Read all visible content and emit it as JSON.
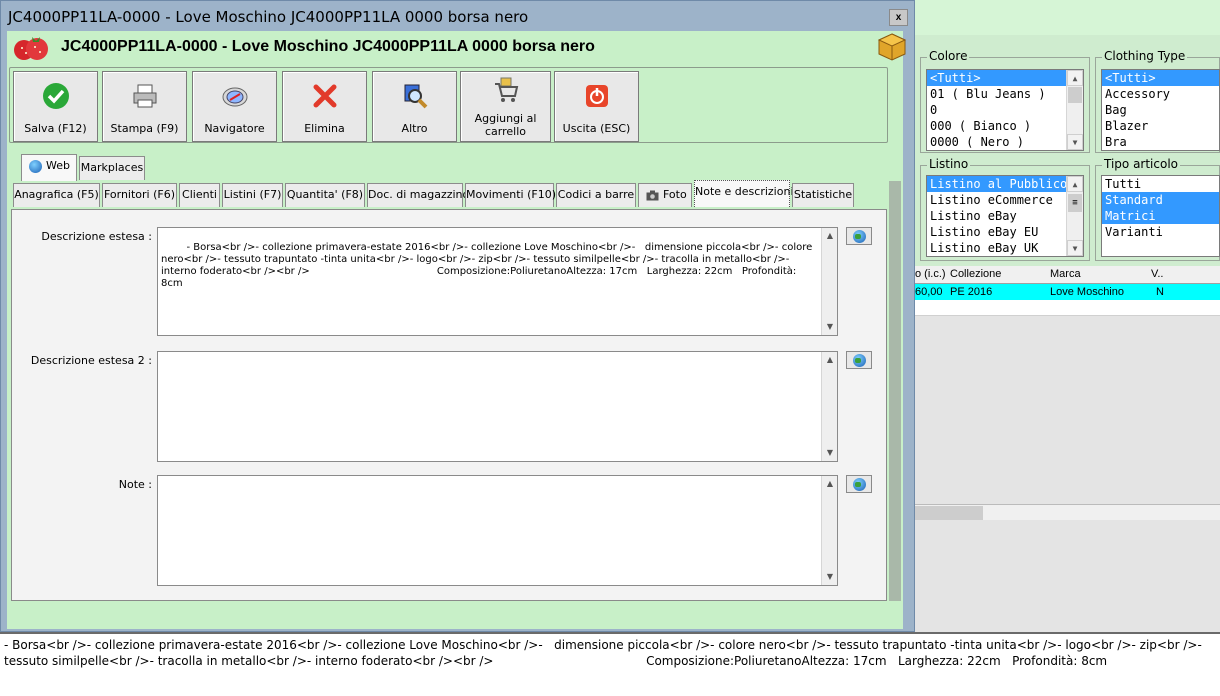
{
  "window": {
    "title": "JC4000PP11LA-0000 - Love Moschino JC4000PP11LA 0000 borsa nero",
    "header_title": "JC4000PP11LA-0000 - Love Moschino JC4000PP11LA 0000 borsa nero",
    "close_label": "x"
  },
  "toolbar": {
    "buttons": [
      {
        "label": "Salva (F12)",
        "icon": "checkmark-icon"
      },
      {
        "label": "Stampa (F9)",
        "icon": "printer-icon"
      },
      {
        "label": "Navigatore",
        "icon": "compass-icon"
      },
      {
        "label": "Elimina",
        "icon": "delete-x-icon"
      },
      {
        "label": "Altro",
        "icon": "magnifier-icon"
      },
      {
        "label": "Aggiungi al carrello",
        "icon": "cart-icon"
      },
      {
        "label": "Uscita (ESC)",
        "icon": "exit-icon"
      }
    ]
  },
  "tabs_top": [
    {
      "label": "Web",
      "active": true
    },
    {
      "label": "Markplaces",
      "active": false
    }
  ],
  "tabs_main": [
    {
      "label": "Anagrafica (F5)"
    },
    {
      "label": "Fornitori (F6)"
    },
    {
      "label": "Clienti"
    },
    {
      "label": "Listini (F7)"
    },
    {
      "label": "Quantita' (F8)"
    },
    {
      "label": "Doc. di magazzino"
    },
    {
      "label": "Movimenti (F10)"
    },
    {
      "label": "Codici a barre"
    },
    {
      "label": "Foto"
    },
    {
      "label": "Note e descrizioni",
      "active": true
    },
    {
      "label": "Statistiche"
    }
  ],
  "fields": {
    "desc_label": "Descrizione estesa :",
    "desc_value": "- Borsa<br />- collezione primavera-estate 2016<br />- collezione Love Moschino<br />-   dimensione piccola<br />- colore nero<br />- tessuto trapuntato -tinta unita<br />- logo<br />- zip<br />- tessuto similpelle<br />- tracolla in metallo<br />- interno foderato<br /><br />                                        Composizione:PoliuretanoAltezza: 17cm   Larghezza: 22cm   Profondità: 8cm",
    "desc2_label": "Descrizione estesa 2 :",
    "desc2_value": "",
    "note_label": "Note :",
    "note_value": ""
  },
  "side": {
    "colore_label": "Colore",
    "colore_items": [
      "<Tutti>",
      "01 ( Blu Jeans )",
      "0",
      "000 ( Bianco )",
      "0000 ( Nero )"
    ],
    "clothing_label": "Clothing Type",
    "clothing_items": [
      "<Tutti>",
      "Accessory",
      "Bag",
      "Blazer",
      "Bra"
    ],
    "listino_label": "Listino",
    "listino_items": [
      "Listino al Pubblico",
      "Listino eCommerce",
      "Listino eBay",
      "Listino eBay EU",
      "Listino eBay UK"
    ],
    "tipo_label": "Tipo articolo",
    "tipo_items": [
      "Tutti",
      "Standard",
      "Matrici",
      "Varianti"
    ],
    "grid_headers": [
      "o (i.c.)",
      "Collezione",
      "Marca",
      "V.."
    ],
    "grid_row": [
      "60,00",
      "PE 2016",
      "Love Moschino",
      "N"
    ]
  },
  "bottom_memo": "- Borsa<br />- collezione primavera-estate 2016<br />- collezione Love Moschino<br />-   dimensione piccola<br />- colore nero<br />- tessuto trapuntato -tinta unita<br />- logo<br />- zip<br />- tessuto similpelle<br />- tracolla in metallo<br />- interno foderato<br /><br />                                        Composizione:PoliuretanoAltezza: 17cm   Larghezza: 22cm   Profondità: 8cm",
  "colors": {
    "title_bar": "#9db3c9",
    "client_bg": "#c8f0c8",
    "selection": "#3399ff",
    "grid_highlight": "#00ffff"
  }
}
